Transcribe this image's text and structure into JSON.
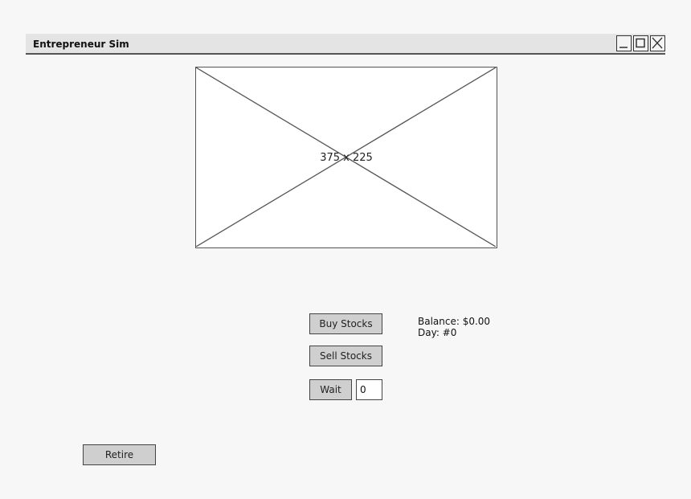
{
  "window": {
    "title": "Entrepreneur Sim",
    "controls": [
      "minimize-icon",
      "maximize-icon",
      "close-icon"
    ]
  },
  "image_placeholder": {
    "label": "375 x 225"
  },
  "actions": {
    "buy_label": "Buy Stocks",
    "sell_label": "Sell Stocks",
    "wait_label": "Wait",
    "wait_value": "0",
    "retire_label": "Retire"
  },
  "status": {
    "balance": "Balance: $0.00",
    "day": "Day: #0"
  }
}
